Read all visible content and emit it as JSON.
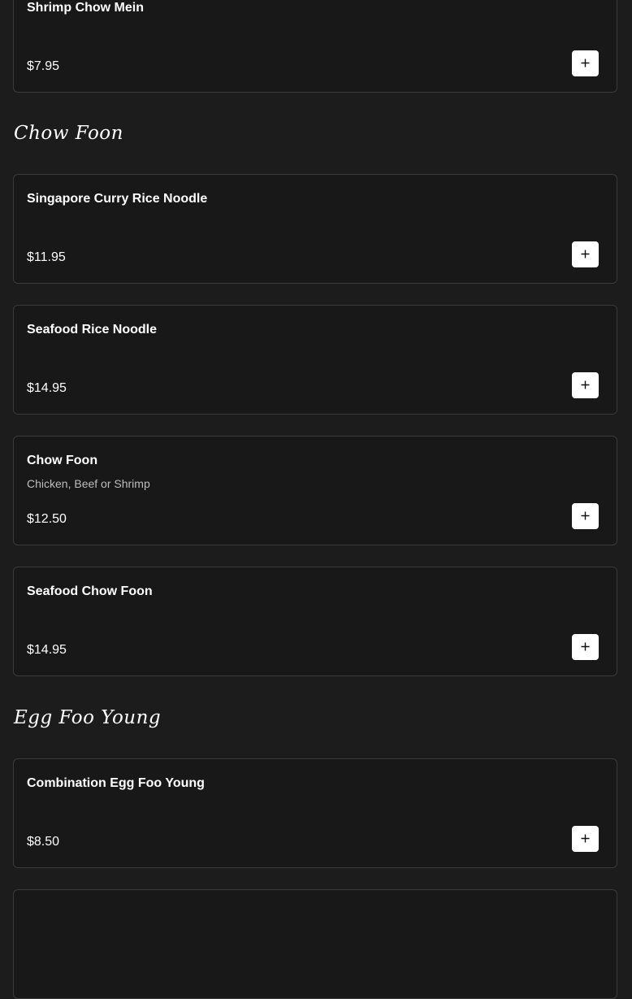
{
  "sections": [
    {
      "title": "",
      "items": [
        {
          "name": "Shrimp Chow Mein",
          "description": "",
          "price": "$7.95"
        }
      ]
    },
    {
      "title": "Chow Foon",
      "items": [
        {
          "name": "Singapore Curry Rice Noodle",
          "description": "",
          "price": "$11.95"
        },
        {
          "name": "Seafood Rice Noodle",
          "description": "",
          "price": "$14.95"
        },
        {
          "name": "Chow Foon",
          "description": "Chicken, Beef or Shrimp",
          "price": "$12.50"
        },
        {
          "name": "Seafood Chow Foon",
          "description": "",
          "price": "$14.95"
        }
      ]
    },
    {
      "title": "Egg Foo Young",
      "items": [
        {
          "name": "Combination Egg Foo Young",
          "description": "",
          "price": "$8.50"
        },
        {
          "name": "",
          "description": "",
          "price": ""
        }
      ]
    }
  ],
  "icons": {
    "add_button": "plus-icon"
  },
  "colors": {
    "background": "#1c1c1c",
    "card_background": "#181818",
    "card_border": "#3a3a3a",
    "button_background": "#ffffff",
    "button_icon": "#111111",
    "description_text": "#bdbdbd"
  }
}
